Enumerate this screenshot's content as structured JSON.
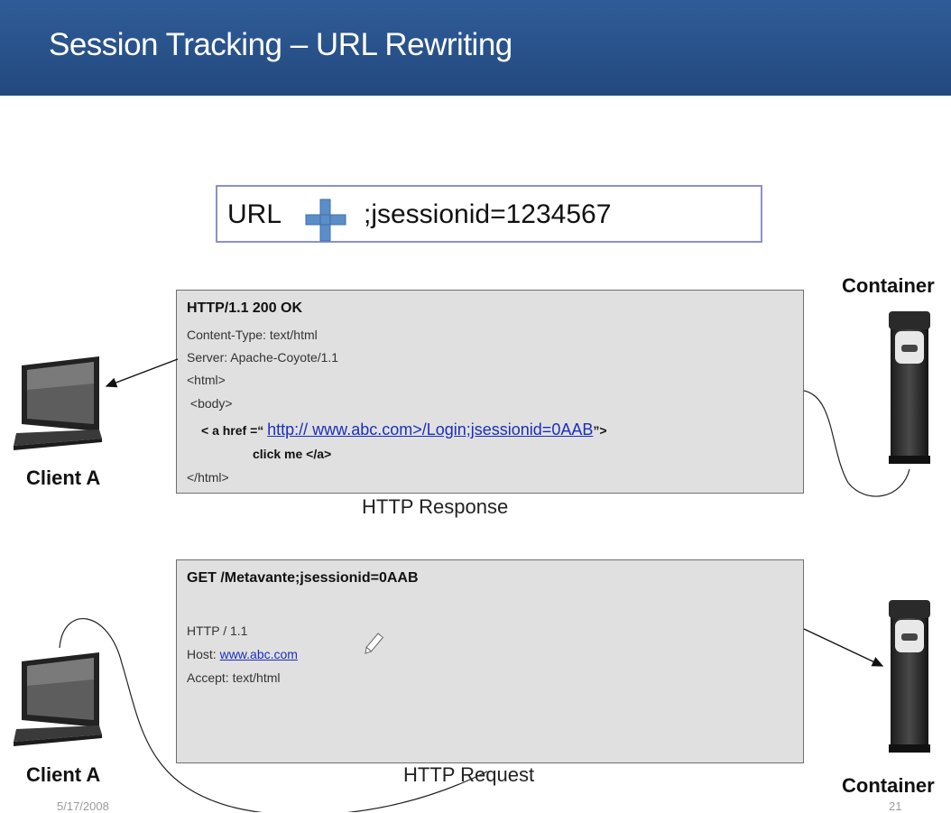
{
  "slide": {
    "title": "Session Tracking – URL Rewriting",
    "date": "5/17/2008",
    "page_number": "21"
  },
  "url_box": {
    "url_label": "URL",
    "plus_icon": "plus-icon",
    "session_param": ";jsessionid=1234567"
  },
  "response": {
    "status_line": "HTTP/1.1 200 OK",
    "content_type": "Content-Type: text/html",
    "server": "Server: Apache-Coyote/1.1",
    "html_open": "<html>",
    "body_open": " <body>",
    "anchor_prefix": "< a href =“",
    "anchor_url": "http:// www.abc.com>/Login;jsessionid=0AAB",
    "anchor_suffix": "”>",
    "anchor_text": "click me </a>",
    "html_close": "</html>",
    "caption": "HTTP Response"
  },
  "request": {
    "request_line": "GET /Metavante;jsessionid=0AAB",
    "protocol": "HTTP / 1.1",
    "host_label": "Host: ",
    "host_value": "www.abc.com",
    "accept": "Accept: text/html",
    "caption": "HTTP Request"
  },
  "labels": {
    "client_top": "Client A",
    "client_bottom": "Client A",
    "container_top": "Container",
    "container_bottom": "Container"
  },
  "colors": {
    "header_bg": "#2a538b",
    "panel_bg": "#e0e0e0",
    "link": "#1a2fbf",
    "plus_icon": "#5b8ec9",
    "url_box_border": "#8e8fcf"
  }
}
